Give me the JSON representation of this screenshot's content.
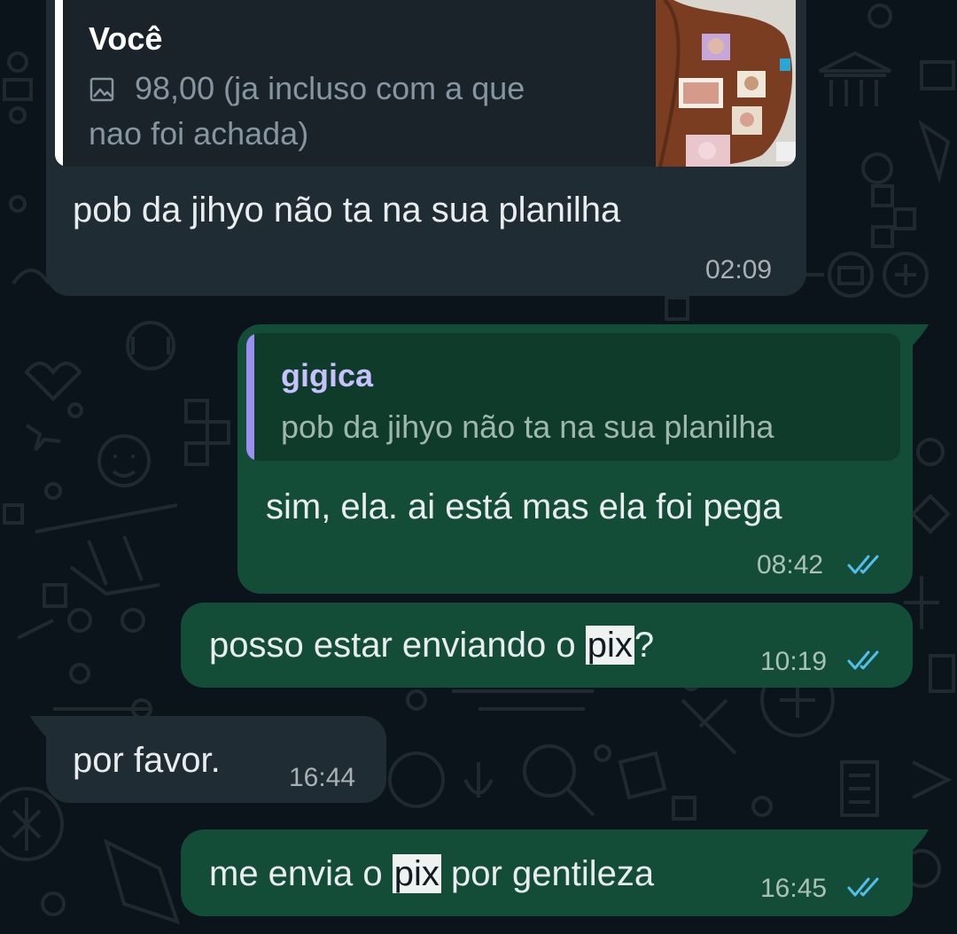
{
  "colors": {
    "background": "#0b141a",
    "incoming_bubble": "#202c33",
    "outgoing_bubble": "#144d37",
    "quote_in_bar": "#ffffff",
    "quote_out_bar": "#9b8ff2",
    "read_ticks": "#53bdeb"
  },
  "messages": [
    {
      "direction": "incoming",
      "quote": {
        "author": "Você",
        "icon": "image-icon",
        "line1": "98,00 (ja incluso com a que",
        "line2": "nao foi achada)"
      },
      "text": "pob da jihyo não ta na sua planilha",
      "time": "02:09"
    },
    {
      "direction": "outgoing",
      "quote": {
        "author": "gigica",
        "text": "pob da jihyo não ta na sua planilha"
      },
      "text": "sim, ela. ai está mas ela foi pega",
      "time": "08:42",
      "status": "read"
    },
    {
      "direction": "outgoing",
      "text_before": "posso estar enviando o ",
      "highlight": "pix",
      "text_after": "?",
      "time": "10:19",
      "status": "read"
    },
    {
      "direction": "incoming",
      "text": "por favor.",
      "time": "16:44"
    },
    {
      "direction": "outgoing",
      "text_before": "me envia o ",
      "highlight": "pix",
      "text_after": " por gentileza",
      "time": "16:45",
      "status": "read"
    }
  ]
}
